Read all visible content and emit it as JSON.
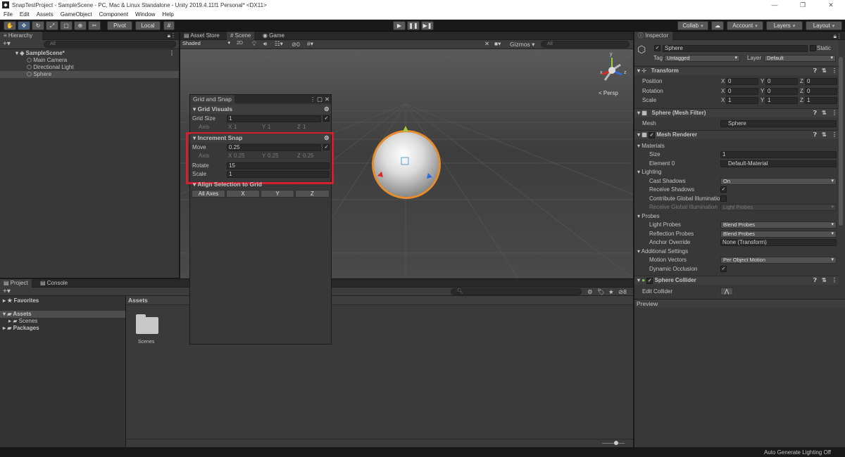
{
  "window": {
    "title": "SnapTestProject - SampleScene - PC, Mac & Linux Standalone - Unity 2019.4.11f1 Personal* <DX11>",
    "minimize": "—",
    "maximize": "❐",
    "close": "✕"
  },
  "menu": [
    "File",
    "Edit",
    "Assets",
    "GameObject",
    "Component",
    "Window",
    "Help"
  ],
  "toolbar": {
    "pivot": "Pivot",
    "local": "Local",
    "collab": "Collab",
    "account": "Account",
    "layers": "Layers",
    "layout": "Layout"
  },
  "hierarchy": {
    "tab": "Hierarchy",
    "search_placeholder": "All",
    "scene": "SampleScene*",
    "items": [
      "Main Camera",
      "Directional Light",
      "Sphere"
    ]
  },
  "scene_tabs": {
    "asset_store": "Asset Store",
    "scene": "Scene",
    "game": "Game"
  },
  "scene_bar": {
    "shading": "Shaded",
    "mode2d": "2D",
    "hidden_count": "0",
    "gizmos": "Gizmos",
    "search_placeholder": "All"
  },
  "scene_view": {
    "persp": "< Persp",
    "axis_y": "y",
    "axis_x": "x",
    "axis_z": "z"
  },
  "grid_snap": {
    "title": "Grid and Snap",
    "grid_visuals": "Grid Visuals",
    "grid_size_label": "Grid Size",
    "grid_size": "1",
    "axis_label": "Axis",
    "gx_label": "X",
    "gx": "1",
    "gy_label": "Y",
    "gy": "1",
    "gz_label": "Z",
    "gz": "1",
    "increment_snap": "Increment Snap",
    "move_label": "Move",
    "move": "0.25",
    "saxis_label": "Axis",
    "sx_label": "X",
    "sx": "0.25",
    "sy_label": "Y",
    "sy": "0.25",
    "sz_label": "Z",
    "sz": "0.25",
    "rotate_label": "Rotate",
    "rotate": "15",
    "scale_label": "Scale",
    "scale": "1",
    "align": "Align Selection to Grid",
    "buttons": [
      "All Axes",
      "X",
      "Y",
      "Z"
    ]
  },
  "project": {
    "tab_project": "Project",
    "tab_console": "Console",
    "favorites": "Favorites",
    "assets": "Assets",
    "scenes": "Scenes",
    "packages": "Packages",
    "breadcrumb": "Assets",
    "folder": "Scenes",
    "hidden_count": "8"
  },
  "inspector": {
    "tab": "Inspector",
    "name": "Sphere",
    "static": "Static",
    "tag_label": "Tag",
    "tag": "Untagged",
    "layer_label": "Layer",
    "layer": "Default",
    "transform": "Transform",
    "position_label": "Position",
    "px": "0",
    "py": "0",
    "pz": "0",
    "rotation_label": "Rotation",
    "rx": "0",
    "ry": "0",
    "rz": "0",
    "scale_label": "Scale",
    "scx": "1",
    "scy": "1",
    "scz": "1",
    "axis_x": "X",
    "axis_y": "Y",
    "axis_z": "Z",
    "mesh_filter": "Sphere (Mesh Filter)",
    "mesh_label": "Mesh",
    "mesh": "Sphere",
    "mesh_renderer": "Mesh Renderer",
    "materials": "Materials",
    "size_label": "Size",
    "size": "1",
    "element0_label": "Element 0",
    "element0": "Default-Material",
    "lighting": "Lighting",
    "cast_label": "Cast Shadows",
    "cast": "On",
    "receive_label": "Receive Shadows",
    "contrib_label": "Contribute Global Illumination",
    "rgi_label": "Receive Global Illumination",
    "rgi": "Light Probes",
    "probes": "Probes",
    "lp_label": "Light Probes",
    "lp": "Blend Probes",
    "rp_label": "Reflection Probes",
    "rp": "Blend Probes",
    "anchor_label": "Anchor Override",
    "anchor": "None (Transform)",
    "additional": "Additional Settings",
    "mv_label": "Motion Vectors",
    "mv": "Per Object Motion",
    "dyn_label": "Dynamic Occlusion",
    "collider": "Sphere Collider",
    "edit_collider": "Edit Collider",
    "preview": "Preview"
  },
  "status": {
    "text": "Auto Generate Lighting Off"
  }
}
